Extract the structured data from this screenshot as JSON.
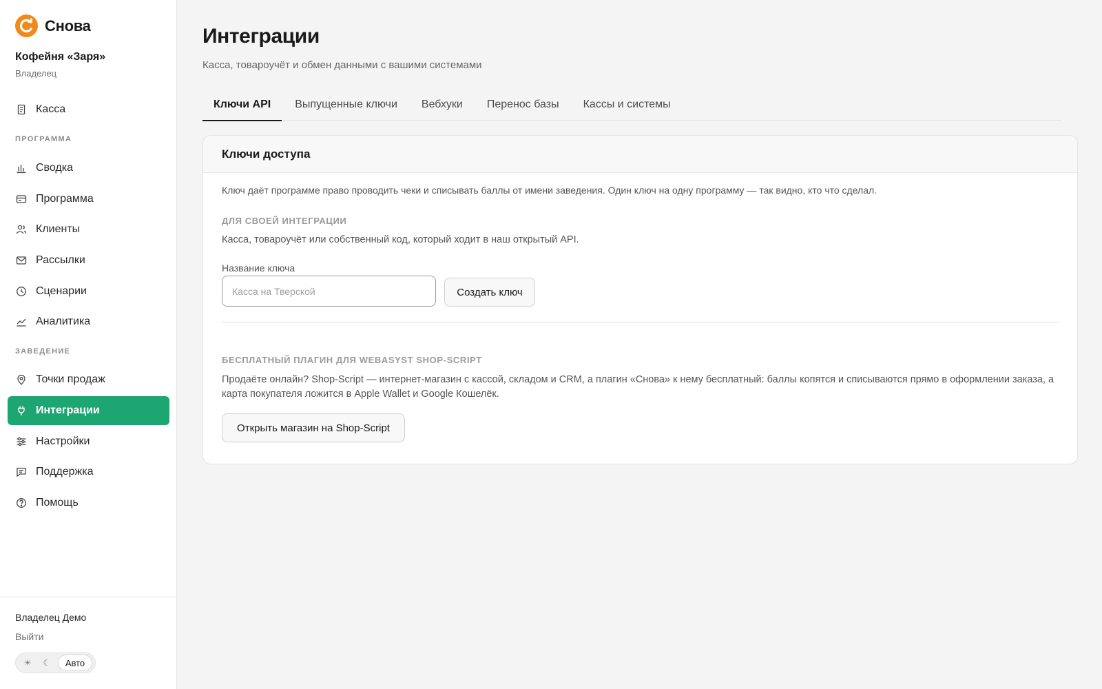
{
  "brand": {
    "name": "Снова",
    "accent_color": "#f08a1c"
  },
  "venue": {
    "name": "Кофейня «Заря»",
    "role": "Владелец"
  },
  "sidebar": {
    "top_item": {
      "label": "Касса",
      "icon": "receipt-icon"
    },
    "section_program": "ПРОГРАММА",
    "program_items": [
      {
        "label": "Сводка",
        "icon": "bar-chart-icon"
      },
      {
        "label": "Программа",
        "icon": "card-icon"
      },
      {
        "label": "Клиенты",
        "icon": "users-icon"
      },
      {
        "label": "Рассылки",
        "icon": "mail-icon"
      },
      {
        "label": "Сценарии",
        "icon": "clock-icon"
      },
      {
        "label": "Аналитика",
        "icon": "trend-icon"
      }
    ],
    "section_venue": "ЗАВЕДЕНИЕ",
    "venue_items": [
      {
        "label": "Точки продаж",
        "icon": "pin-icon"
      },
      {
        "label": "Интеграции",
        "icon": "plug-icon",
        "active": true
      },
      {
        "label": "Настройки",
        "icon": "sliders-icon"
      },
      {
        "label": "Поддержка",
        "icon": "chat-icon"
      },
      {
        "label": "Помощь",
        "icon": "help-icon"
      }
    ],
    "active_color": "#1ea672"
  },
  "footer": {
    "user_name": "Владелец Демо",
    "logout": "Выйти",
    "theme": {
      "light_icon": "☀",
      "dark_icon": "☾",
      "auto": "Авто",
      "selected": "Авто"
    }
  },
  "page": {
    "title": "Интеграции",
    "subtitle": "Касса, товароучёт и обмен данными с вашими системами"
  },
  "tabs": [
    {
      "label": "Ключи API",
      "active": true
    },
    {
      "label": "Выпущенные ключи"
    },
    {
      "label": "Вебхуки"
    },
    {
      "label": "Перенос базы"
    },
    {
      "label": "Кассы и системы"
    }
  ],
  "card": {
    "title": "Ключи доступа",
    "description": "Ключ даёт программе право проводить чеки и списывать баллы от имени заведения. Один ключ на одну программу — так видно, кто что сделал.",
    "own": {
      "title": "ДЛЯ СВОЕЙ ИНТЕГРАЦИИ",
      "text": "Касса, товароучёт или собственный код, который ходит в наш открытый API.",
      "field_label": "Название ключа",
      "input_value": "",
      "input_placeholder": "Касса на Тверской",
      "create_button": "Создать ключ"
    },
    "plugin": {
      "title": "БЕСПЛАТНЫЙ ПЛАГИН ДЛЯ WEBASYST SHOP-SCRIPT",
      "text": "Продаёте онлайн? Shop-Script — интернет-магазин с кассой, складом и CRM, а плагин «Снова» к нему бесплатный: баллы копятся и списываются прямо в оформлении заказа, а карта покупателя ложится в Apple Wallet и Google Кошелёк.",
      "button": "Открыть магазин на Shop-Script"
    }
  }
}
